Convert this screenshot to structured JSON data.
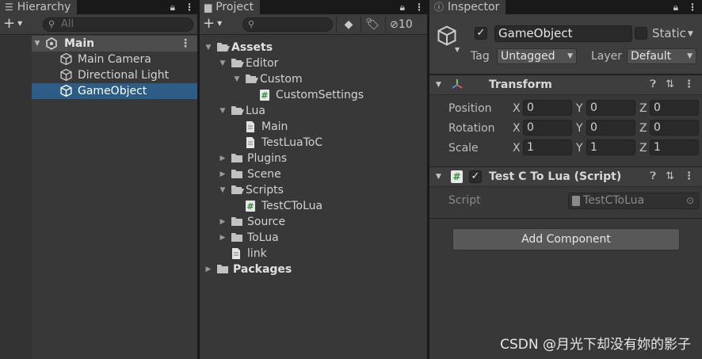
{
  "hierarchy": {
    "tab_title": "Hierarchy",
    "search_placeholder": "All",
    "scene_name": "Main",
    "items": [
      {
        "label": "Main Camera"
      },
      {
        "label": "Directional Light"
      },
      {
        "label": "GameObject",
        "selected": true
      }
    ]
  },
  "project": {
    "tab_title": "Project",
    "hidden_count": "10",
    "tree": [
      {
        "label": "Assets"
      },
      {
        "label": "Editor"
      },
      {
        "label": "Custom"
      },
      {
        "label": "CustomSettings"
      },
      {
        "label": "Lua"
      },
      {
        "label": "Main"
      },
      {
        "label": "TestLuaToC"
      },
      {
        "label": "Plugins"
      },
      {
        "label": "Scene"
      },
      {
        "label": "Scripts"
      },
      {
        "label": "TestCToLua"
      },
      {
        "label": "Source"
      },
      {
        "label": "ToLua"
      },
      {
        "label": "link"
      },
      {
        "label": "Packages"
      }
    ]
  },
  "inspector": {
    "tab_title": "Inspector",
    "object_name": "GameObject",
    "static_label": "Static",
    "tag_label": "Tag",
    "tag_value": "Untagged",
    "layer_label": "Layer",
    "layer_value": "Default",
    "transform": {
      "title": "Transform",
      "position_label": "Position",
      "rotation_label": "Rotation",
      "scale_label": "Scale",
      "axis_x": "X",
      "axis_y": "Y",
      "axis_z": "Z",
      "position": [
        "0",
        "0",
        "0"
      ],
      "rotation": [
        "0",
        "0",
        "0"
      ],
      "scale": [
        "1",
        "1",
        "1"
      ]
    },
    "script_component": {
      "title": "Test C To Lua (Script)",
      "script_label": "Script",
      "script_value": "TestCToLua"
    },
    "add_component_label": "Add Component"
  },
  "watermark": "CSDN @月光下却没有妳的影子",
  "colors": {
    "selection": "#2c5d87",
    "panel_bg": "#383838",
    "script_icon": "#3a9e4f"
  }
}
